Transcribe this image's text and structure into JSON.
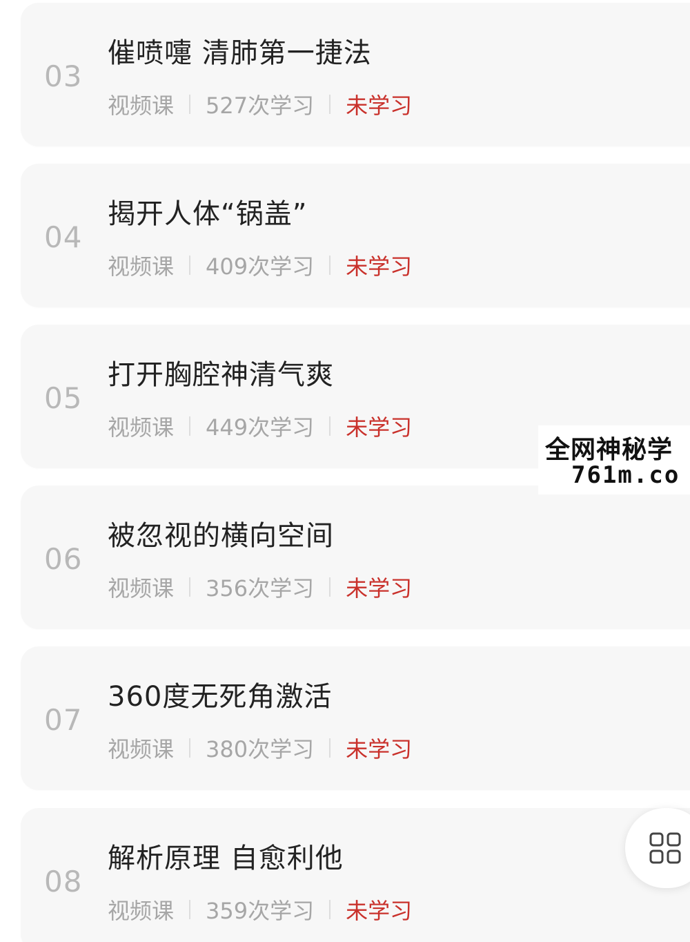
{
  "lessons": [
    {
      "number": "03",
      "title": "催喷嚏 清肺第一捷法",
      "type": "视频课",
      "views": "527次学习",
      "status": "未学习"
    },
    {
      "number": "04",
      "title": "揭开人体“锅盖”",
      "type": "视频课",
      "views": "409次学习",
      "status": "未学习"
    },
    {
      "number": "05",
      "title": "打开胸腔神清气爽",
      "type": "视频课",
      "views": "449次学习",
      "status": "未学习"
    },
    {
      "number": "06",
      "title": "被忽视的横向空间",
      "type": "视频课",
      "views": "356次学习",
      "status": "未学习"
    },
    {
      "number": "07",
      "title": "360度无死角激活",
      "type": "视频课",
      "views": "380次学习",
      "status": "未学习"
    },
    {
      "number": "08",
      "title": "解析原理 自愈利他",
      "type": "视频课",
      "views": "359次学习",
      "status": "未学习"
    }
  ],
  "watermark": {
    "line1": "全网神秘学",
    "line2": "761m.co"
  },
  "fab": {
    "icon": "grid-icon"
  },
  "colors": {
    "card_bg": "#f7f7f7",
    "status_red": "#c9312b",
    "muted_text": "#a6a6a6",
    "number_gray": "#b8b8b8",
    "title_text": "#222222"
  }
}
